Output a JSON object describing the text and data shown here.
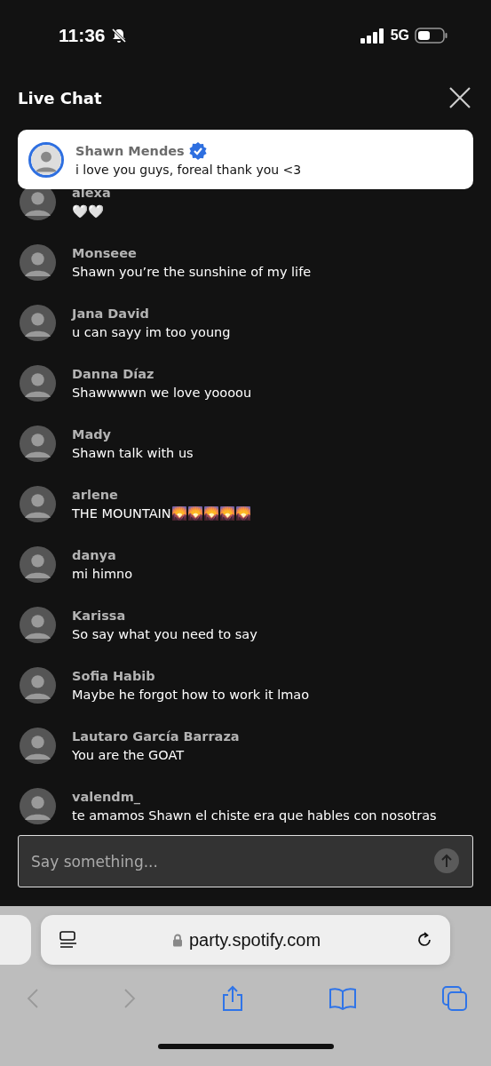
{
  "status_bar": {
    "time": "11:36",
    "network": "5G"
  },
  "header": {
    "title": "Live Chat"
  },
  "pinned": {
    "name": "Shawn Mendes",
    "verified": true,
    "text": "i love you guys, foreal thank you <3"
  },
  "messages": [
    {
      "name": "alexa",
      "text": "🤍🤍"
    },
    {
      "name": "Monseee",
      "text": "Shawn you’re the sunshine of my life"
    },
    {
      "name": "Jana David",
      "text": "u can sayy im too young"
    },
    {
      "name": "Danna Díaz",
      "text": "Shawwwwn we love yoooou"
    },
    {
      "name": "Mady",
      "text": "Shawn talk with us"
    },
    {
      "name": "arlene",
      "text": "THE MOUNTAIN🌄🌄🌄🌄🌄"
    },
    {
      "name": "danya",
      "text": "mi himno"
    },
    {
      "name": "Karissa",
      "text": "So say what you need to say"
    },
    {
      "name": "Sofia Habib",
      "text": "Maybe he forgot how to work it lmao"
    },
    {
      "name": "Lautaro García Barraza",
      "text": "You are the GOAT"
    },
    {
      "name": "valendm_",
      "text": "te amamos Shawn el chiste era que hables con nosotras"
    }
  ],
  "composer": {
    "placeholder": "Say something..."
  },
  "browser": {
    "url": "party.spotify.com"
  }
}
